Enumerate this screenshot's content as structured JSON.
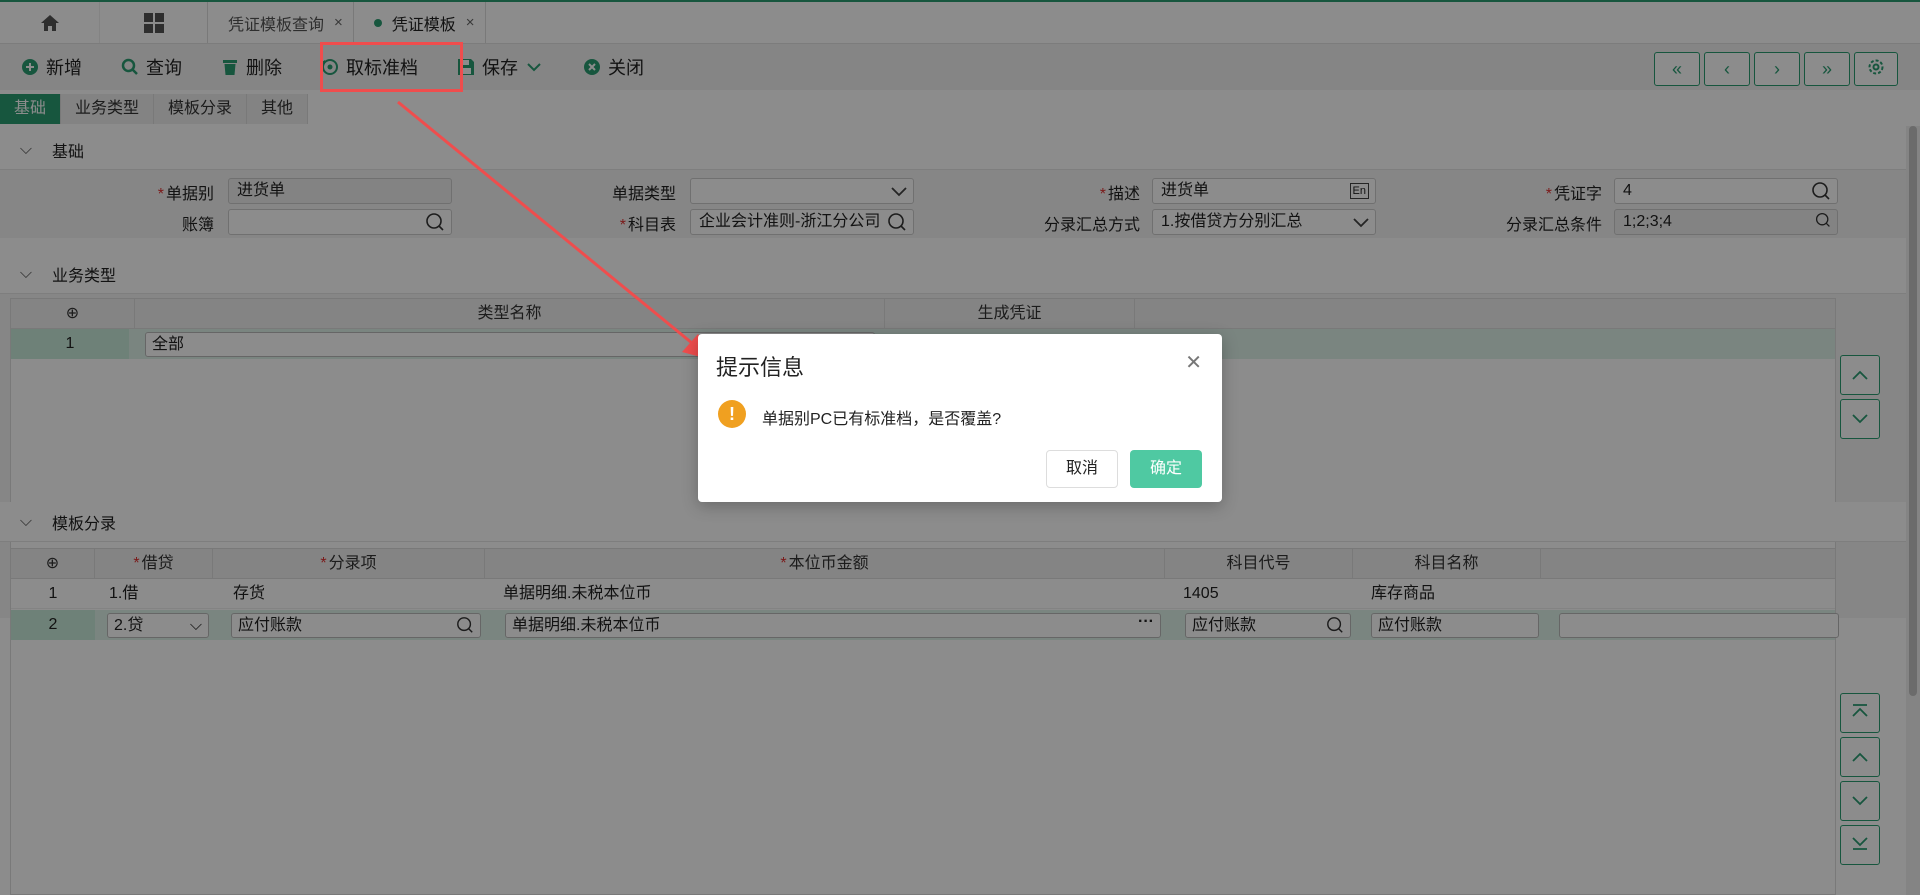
{
  "tabs": [
    {
      "label": "凭证模板查询"
    },
    {
      "label": "凭证模板"
    }
  ],
  "toolbar": {
    "add": "新增",
    "query": "查询",
    "delete": "删除",
    "cancel_standard": "取标准档",
    "save": "保存",
    "close": "关闭"
  },
  "subtabs": [
    "基础",
    "业务类型",
    "模板分录",
    "其他"
  ],
  "basic": {
    "title": "基础",
    "doc_type_label": "单据别",
    "doc_type_value": "进货单",
    "doc_category_label": "单据类型",
    "doc_category_value": "",
    "desc_label": "描述",
    "desc_value": "进货单",
    "voucher_word_label": "凭证字",
    "voucher_word_value": "4",
    "ledger_label": "账簿",
    "ledger_value": "",
    "account_table_label": "科目表",
    "account_table_value": "企业会计准则-浙江分公司",
    "summary_method_label": "分录汇总方式",
    "summary_method_value": "1.按借贷方分别汇总",
    "summary_cond_label": "分录汇总条件",
    "summary_cond_value": "1;2;3;4"
  },
  "business": {
    "title": "业务类型",
    "headers": [
      "类型名称",
      "生成凭证"
    ],
    "rows": [
      {
        "no": "1",
        "name": "全部"
      }
    ]
  },
  "entries": {
    "title": "模板分录",
    "headers": [
      "借贷",
      "分录项",
      "本位币金额",
      "科目代号",
      "科目名称"
    ],
    "rows": [
      {
        "no": "1",
        "dc": "1.借",
        "item": "存货",
        "amount": "单据明细.未税本位币",
        "code": "1405",
        "name": "库存商品"
      },
      {
        "no": "2",
        "dc": "2.贷",
        "item": "应付账款",
        "amount": "单据明细.未税本位币",
        "code": "应付账款",
        "name": "应付账款"
      }
    ]
  },
  "dialog": {
    "title": "提示信息",
    "message": "单据别PC已有标准档，是否覆盖?",
    "cancel": "取消",
    "ok": "确定"
  },
  "colors": {
    "accent": "#2a9d72",
    "highlight": "#ef4d4d",
    "ok_button": "#4fc9a2",
    "warning": "#f0a020"
  }
}
